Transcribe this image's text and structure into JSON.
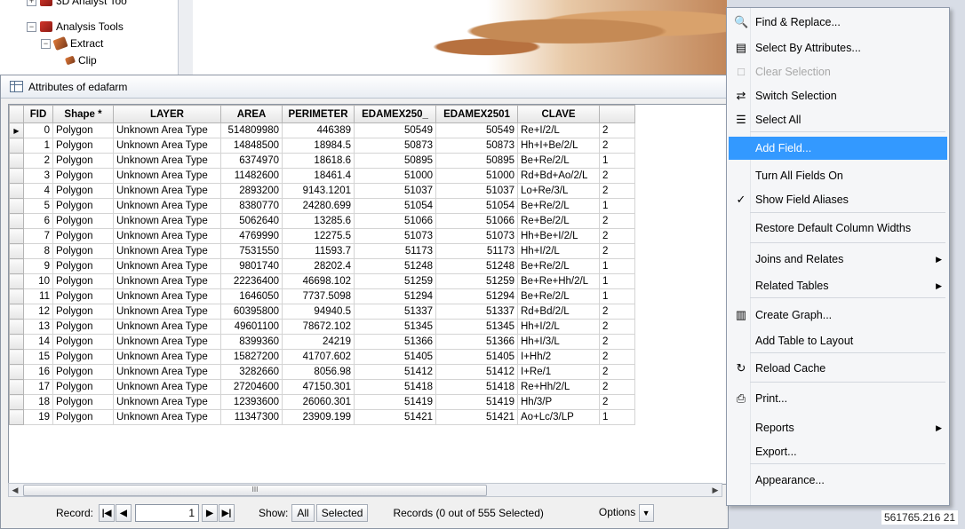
{
  "tree": {
    "items": [
      {
        "label": "3D Analyst Too",
        "expander": "+"
      },
      {
        "label": "Analysis Tools",
        "expander": "−"
      },
      {
        "label": "Extract",
        "expander": "−"
      },
      {
        "label": "Clip",
        "expander": ""
      }
    ]
  },
  "window": {
    "title": "Attributes of edafarm"
  },
  "table": {
    "columns": [
      "FID",
      "Shape *",
      "LAYER",
      "AREA",
      "PERIMETER",
      "EDAMEX250_",
      "EDAMEX2501",
      "CLAVE",
      ""
    ],
    "rows": [
      [
        "0",
        "Polygon",
        "Unknown Area Type",
        "514809980",
        "446389",
        "50549",
        "50549",
        "Re+I/2/L",
        "2"
      ],
      [
        "1",
        "Polygon",
        "Unknown Area Type",
        "14848500",
        "18984.5",
        "50873",
        "50873",
        "Hh+I+Be/2/L",
        "2"
      ],
      [
        "2",
        "Polygon",
        "Unknown Area Type",
        "6374970",
        "18618.6",
        "50895",
        "50895",
        "Be+Re/2/L",
        "1"
      ],
      [
        "3",
        "Polygon",
        "Unknown Area Type",
        "11482600",
        "18461.4",
        "51000",
        "51000",
        "Rd+Bd+Ao/2/L",
        "2"
      ],
      [
        "4",
        "Polygon",
        "Unknown Area Type",
        "2893200",
        "9143.1201",
        "51037",
        "51037",
        "Lo+Re/3/L",
        "2"
      ],
      [
        "5",
        "Polygon",
        "Unknown Area Type",
        "8380770",
        "24280.699",
        "51054",
        "51054",
        "Be+Re/2/L",
        "1"
      ],
      [
        "6",
        "Polygon",
        "Unknown Area Type",
        "5062640",
        "13285.6",
        "51066",
        "51066",
        "Re+Be/2/L",
        "2"
      ],
      [
        "7",
        "Polygon",
        "Unknown Area Type",
        "4769990",
        "12275.5",
        "51073",
        "51073",
        "Hh+Be+I/2/L",
        "2"
      ],
      [
        "8",
        "Polygon",
        "Unknown Area Type",
        "7531550",
        "11593.7",
        "51173",
        "51173",
        "Hh+I/2/L",
        "2"
      ],
      [
        "9",
        "Polygon",
        "Unknown Area Type",
        "9801740",
        "28202.4",
        "51248",
        "51248",
        "Be+Re/2/L",
        "1"
      ],
      [
        "10",
        "Polygon",
        "Unknown Area Type",
        "22236400",
        "46698.102",
        "51259",
        "51259",
        "Be+Re+Hh/2/L",
        "1"
      ],
      [
        "11",
        "Polygon",
        "Unknown Area Type",
        "1646050",
        "7737.5098",
        "51294",
        "51294",
        "Be+Re/2/L",
        "1"
      ],
      [
        "12",
        "Polygon",
        "Unknown Area Type",
        "60395800",
        "94940.5",
        "51337",
        "51337",
        "Rd+Bd/2/L",
        "2"
      ],
      [
        "13",
        "Polygon",
        "Unknown Area Type",
        "49601100",
        "78672.102",
        "51345",
        "51345",
        "Hh+I/2/L",
        "2"
      ],
      [
        "14",
        "Polygon",
        "Unknown Area Type",
        "8399360",
        "24219",
        "51366",
        "51366",
        "Hh+I/3/L",
        "2"
      ],
      [
        "15",
        "Polygon",
        "Unknown Area Type",
        "15827200",
        "41707.602",
        "51405",
        "51405",
        "I+Hh/2",
        "2"
      ],
      [
        "16",
        "Polygon",
        "Unknown Area Type",
        "3282660",
        "8056.98",
        "51412",
        "51412",
        "I+Re/1",
        "2"
      ],
      [
        "17",
        "Polygon",
        "Unknown Area Type",
        "27204600",
        "47150.301",
        "51418",
        "51418",
        "Re+Hh/2/L",
        "2"
      ],
      [
        "18",
        "Polygon",
        "Unknown Area Type",
        "12393600",
        "26060.301",
        "51419",
        "51419",
        "Hh/3/P",
        "2"
      ],
      [
        "19",
        "Polygon",
        "Unknown Area Type",
        "11347300",
        "23909.199",
        "51421",
        "51421",
        "Ao+Lc/3/LP",
        "1"
      ]
    ]
  },
  "status": {
    "record_label": "Record:",
    "record_value": "1",
    "show_label": "Show:",
    "show_all": "All",
    "show_selected": "Selected",
    "records_text": "Records (0 out of 555 Selected)",
    "options_label": "Options"
  },
  "menu": {
    "items": [
      {
        "label": "Find & Replace...",
        "icon": "binoculars-icon",
        "glyph": "🔍"
      },
      {
        "label": "Select By Attributes...",
        "icon": "sql-icon",
        "glyph": "▤"
      },
      {
        "label": "Clear Selection",
        "icon": "clear-selection-icon",
        "glyph": "□",
        "disabled": true
      },
      {
        "label": "Switch Selection",
        "icon": "switch-selection-icon",
        "glyph": "⇄"
      },
      {
        "label": "Select All",
        "icon": "select-all-icon",
        "glyph": "☰"
      },
      {
        "label": "Add Field...",
        "highlighted": true
      },
      {
        "label": "Turn All Fields On"
      },
      {
        "label": "Show Field Aliases",
        "icon": "checkmark-icon",
        "glyph": "✓"
      },
      {
        "label": "Restore Default Column Widths"
      },
      {
        "label": "Joins and Relates",
        "submenu": true
      },
      {
        "label": "Related Tables",
        "submenu": true
      },
      {
        "label": "Create Graph...",
        "icon": "graph-icon",
        "glyph": "▥"
      },
      {
        "label": "Add Table to Layout"
      },
      {
        "label": "Reload Cache",
        "icon": "reload-icon",
        "glyph": "↻"
      },
      {
        "label": "Print...",
        "icon": "printer-icon",
        "glyph": "⎙"
      },
      {
        "label": "Reports",
        "submenu": true
      },
      {
        "label": "Export..."
      },
      {
        "label": "Appearance..."
      }
    ]
  },
  "coordinate_text": "561765.216  21",
  "colors": {
    "highlight": "#3399ff",
    "menu_bg": "#f5f6f8"
  }
}
